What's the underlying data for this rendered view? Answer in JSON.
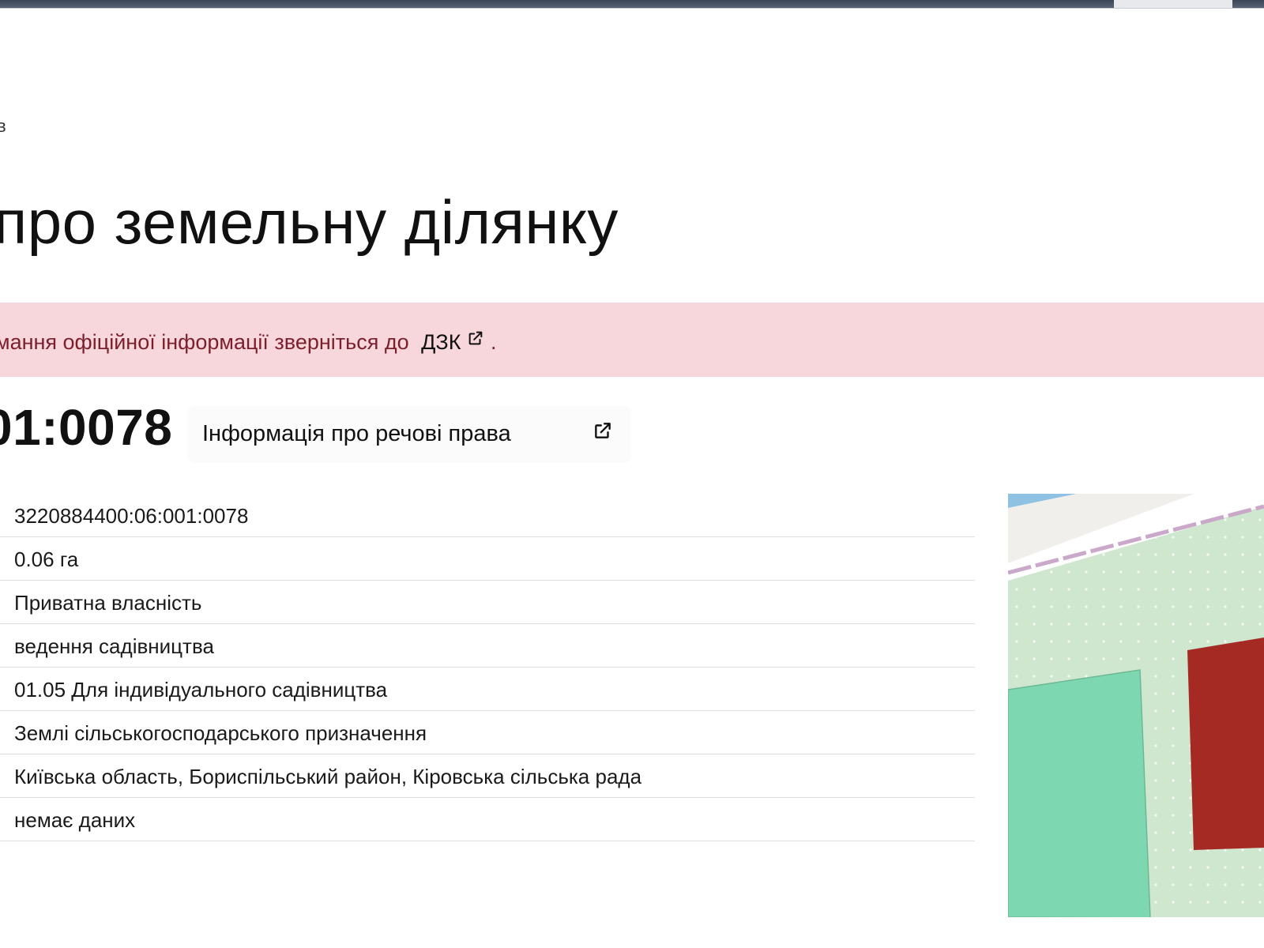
{
  "header": {
    "breadcrumb_fragment": "в"
  },
  "page": {
    "title": "про земельну ділянку"
  },
  "alert": {
    "text": "мання офіційної інформації зверніться до",
    "link_label": "ДЗК",
    "trailing": "."
  },
  "parcel": {
    "cadastral_fragment": "01:0078",
    "rights_button_label": "Інформація про речові права"
  },
  "details": [
    "3220884400:06:001:0078",
    "0.06 га",
    "Приватна власність",
    "ведення садівництва",
    "01.05 Для індивідуального садівництва",
    "Землі сільськогосподарського призначення",
    "Київська область, Бориспільський район, Кіровська сільська рада",
    "немає даних"
  ],
  "map": {
    "colors": {
      "green_area": "#cfe6cf",
      "teal_parcel": "#7dd7b0",
      "red_parcel": "#a52a24",
      "road": "#f1efec",
      "water": "#8fc1e3",
      "boundary": "#c9a8c9"
    }
  },
  "colors": {
    "alert_background": "#f8d7dc",
    "alert_text": "#7a1f2b"
  },
  "icons": {
    "external_link": "external-link-icon"
  }
}
